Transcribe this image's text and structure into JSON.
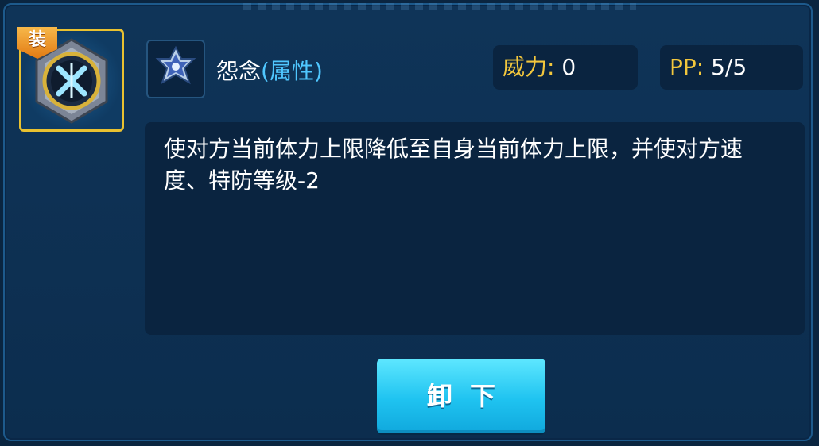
{
  "skill": {
    "equip_badge": "装",
    "name": "怨念",
    "attribute": "(属性)",
    "icon": "shield-cross-icon",
    "type_icon": "hex-star-icon"
  },
  "stats": {
    "power_label": "威力:",
    "power_value": "0",
    "pp_label": "PP:",
    "pp_value": "5/5"
  },
  "description": "使对方当前体力上限降低至自身当前体力上限，并使对方速度、特防等级-2",
  "actions": {
    "unequip_label": "卸下"
  },
  "colors": {
    "panel_bg": "#0f3458",
    "box_bg": "#0a2440",
    "gold": "#f3c73d",
    "attr_blue": "#4fc7ff",
    "button": "#1fc3f0"
  }
}
